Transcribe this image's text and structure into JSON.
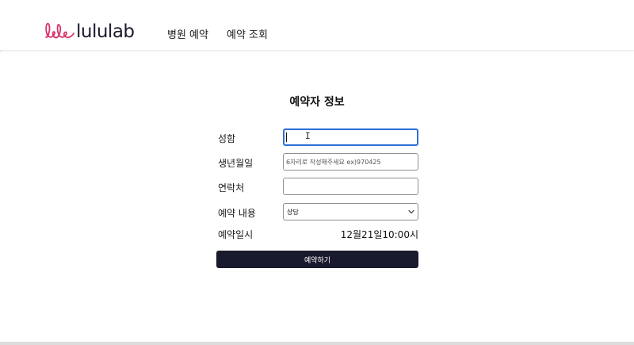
{
  "header": {
    "logo_text": "lululab",
    "logo_mark": "lele",
    "nav": [
      {
        "label": "병원 예약"
      },
      {
        "label": "예약 조회"
      }
    ]
  },
  "form": {
    "title": "예약자 정보",
    "name_label": "성함",
    "name_value": "",
    "birth_label": "생년월일",
    "birth_placeholder": "6자리로 작성해주세요 ex)970425",
    "phone_label": "연락처",
    "phone_value": "",
    "type_label": "예약 내용",
    "type_selected": "상담",
    "date_label": "예약일시",
    "date_value": "12월21일10:00시",
    "submit_label": "예약하기"
  },
  "colors": {
    "brand_pink": "#d8326a",
    "primary_dark": "#1a1a2e",
    "focus_blue": "#2d6fd6"
  },
  "icons": {
    "logo": "lele-logo-icon",
    "select": "chevron-down-icon",
    "cursor": "text-cursor-icon"
  }
}
